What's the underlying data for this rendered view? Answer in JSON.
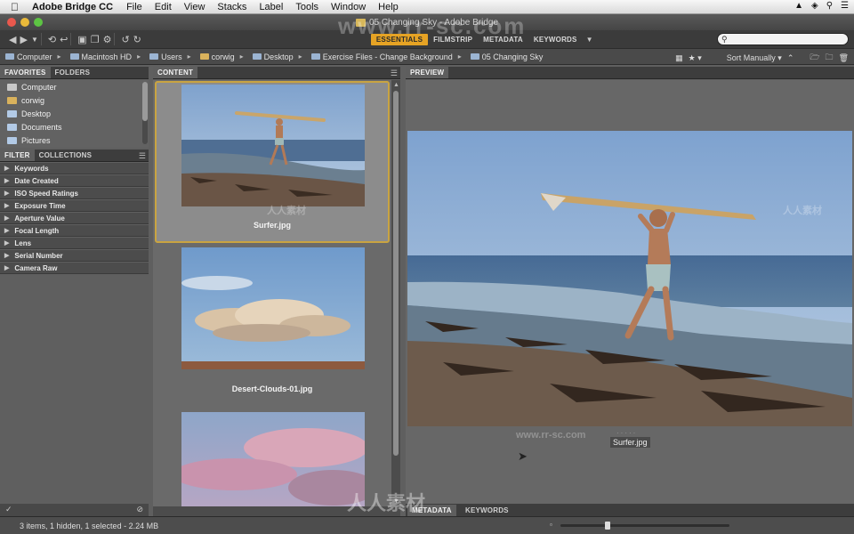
{
  "menubar": {
    "app_name": "Adobe Bridge CC",
    "items": [
      "File",
      "Edit",
      "View",
      "Stacks",
      "Label",
      "Tools",
      "Window",
      "Help"
    ]
  },
  "window": {
    "title": "05 Changing Sky - Adobe Bridge"
  },
  "workspaces": [
    {
      "label": "ESSENTIALS",
      "active": true
    },
    {
      "label": "FILMSTRIP",
      "active": false
    },
    {
      "label": "METADATA",
      "active": false
    },
    {
      "label": "KEYWORDS",
      "active": false
    }
  ],
  "breadcrumbs": [
    "Computer",
    "Macintosh HD",
    "Users",
    "corwig",
    "Desktop",
    "Exercise Files - Change Background",
    "05 Changing Sky"
  ],
  "sort_label": "Sort Manually",
  "left_panel": {
    "tabs": [
      "FAVORITES",
      "FOLDERS"
    ],
    "favorites": [
      {
        "label": "Computer",
        "icon": "computer-icon"
      },
      {
        "label": "corwig",
        "icon": "home-icon"
      },
      {
        "label": "Desktop",
        "icon": "folder-icon"
      },
      {
        "label": "Documents",
        "icon": "folder-icon"
      },
      {
        "label": "Pictures",
        "icon": "folder-icon"
      }
    ],
    "filter_tabs": [
      "FILTER",
      "COLLECTIONS"
    ],
    "filters": [
      "Keywords",
      "Date Created",
      "ISO Speed Ratings",
      "Exposure Time",
      "Aperture Value",
      "Focal Length",
      "Lens",
      "Serial Number",
      "Camera Raw"
    ]
  },
  "content": {
    "tab": "CONTENT",
    "items": [
      {
        "name": "Surfer.jpg",
        "selected": true
      },
      {
        "name": "Desert-Clouds-01.jpg",
        "selected": false
      },
      {
        "name": "",
        "selected": false
      }
    ]
  },
  "preview": {
    "tab": "PREVIEW",
    "caption": "Surfer.jpg"
  },
  "bottom_tabs": [
    "METADATA",
    "KEYWORDS"
  ],
  "status": "3 items, 1 hidden, 1 selected - 2.24 MB",
  "zoom_level": 0.28,
  "watermarks": {
    "url": "www.rr-sc.com",
    "cn": "人人素材"
  },
  "colors": {
    "accent": "#e6a324",
    "selection_border": "#c9a441"
  }
}
